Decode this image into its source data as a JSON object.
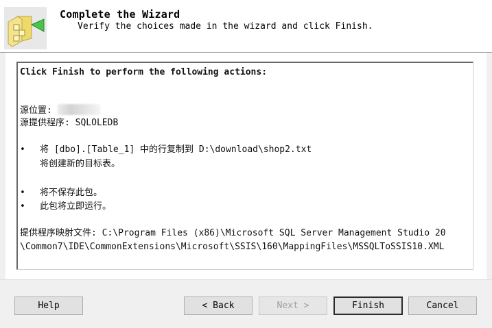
{
  "header": {
    "title": "Complete the Wizard",
    "subtitle": "Verify the choices made in the wizard and click Finish."
  },
  "summary": {
    "heading": "Click Finish to perform the following actions:",
    "source_location_label": "源位置:",
    "source_provider": "源提供程序: SQLOLEDB",
    "bullet_glyph": "•",
    "copy_rows": "将 [dbo].[Table_1] 中的行复制到 D:\\download\\shop2.txt",
    "create_table": "将创建新的目标表。",
    "not_save_package": "将不保存此包。",
    "run_immediately": "此包将立即运行。",
    "mapping_file_line1": "提供程序映射文件: C:\\Program Files (x86)\\Microsoft SQL Server Management Studio 20",
    "mapping_file_line2": "\\Common7\\IDE\\CommonExtensions\\Microsoft\\SSIS\\160\\MappingFiles\\MSSQLToSSIS10.XML"
  },
  "buttons": {
    "help": "Help",
    "back": "< Back",
    "next": "Next >",
    "finish": "Finish",
    "cancel": "Cancel"
  },
  "icons": {
    "wizard": "wizard-folder-arrow-icon"
  }
}
